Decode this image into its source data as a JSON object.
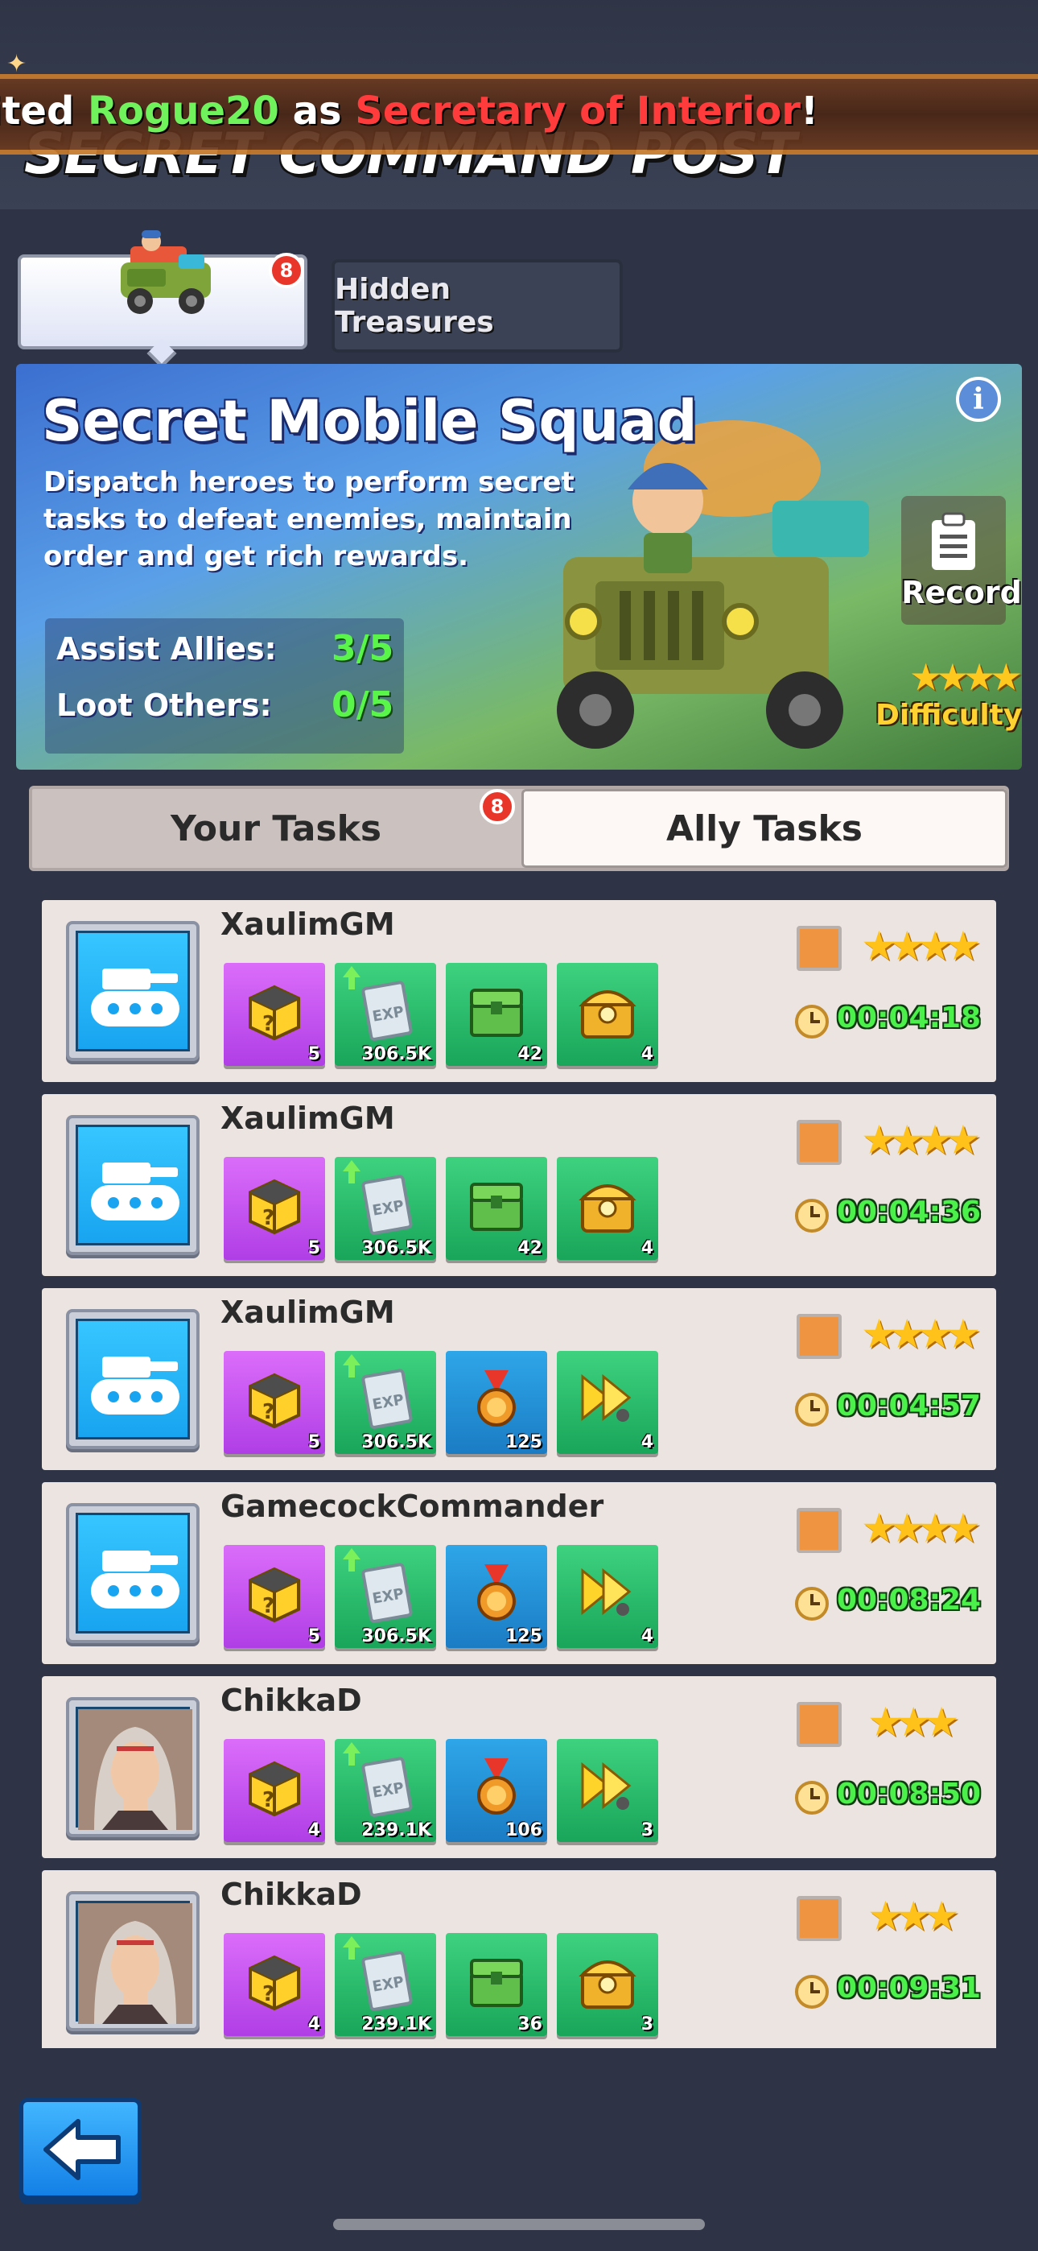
{
  "header": {
    "title": "SECRET COMMAND POST",
    "marquee": {
      "prefix": "ited ",
      "player": "Rogue20",
      "middle": " as ",
      "role": "Secretary of Interior",
      "suffix": "!"
    }
  },
  "top_tabs": {
    "jeep_badge": "8",
    "hidden_label": "Hidden Treasures"
  },
  "hero": {
    "title": "Secret Mobile Squad",
    "description": "Dispatch heroes to perform secret tasks to defeat enemies, maintain order and get rich rewards.",
    "stats": [
      {
        "label": "Assist Allies:",
        "value": "3/5"
      },
      {
        "label": "Loot Others:",
        "value": "0/5"
      }
    ],
    "info_icon": "i",
    "record_label": "Record",
    "difficulty_label": "Difficulty",
    "difficulty_stars": "★★★★"
  },
  "sub_tabs": {
    "your_tasks": "Your Tasks",
    "ally_tasks": "Ally Tasks",
    "badge": "8"
  },
  "tasks": [
    {
      "name": "XaulimGM",
      "avatar": "tank",
      "stars": "★★★★",
      "timer": "00:04:18",
      "rewards": [
        {
          "kind": "mystery-box",
          "color": "purple",
          "count": "5"
        },
        {
          "kind": "exp-book",
          "color": "green",
          "count": "306.5K"
        },
        {
          "kind": "green-chest",
          "color": "green",
          "count": "42"
        },
        {
          "kind": "gold-chest",
          "color": "green",
          "count": "4"
        }
      ]
    },
    {
      "name": "XaulimGM",
      "avatar": "tank",
      "stars": "★★★★",
      "timer": "00:04:36",
      "rewards": [
        {
          "kind": "mystery-box",
          "color": "purple",
          "count": "5"
        },
        {
          "kind": "exp-book",
          "color": "green",
          "count": "306.5K"
        },
        {
          "kind": "green-chest",
          "color": "green",
          "count": "42"
        },
        {
          "kind": "gold-chest",
          "color": "green",
          "count": "4"
        }
      ]
    },
    {
      "name": "XaulimGM",
      "avatar": "tank",
      "stars": "★★★★",
      "timer": "00:04:57",
      "rewards": [
        {
          "kind": "mystery-box",
          "color": "purple",
          "count": "5"
        },
        {
          "kind": "exp-book",
          "color": "green",
          "count": "306.5K"
        },
        {
          "kind": "medal",
          "color": "blue",
          "count": "125"
        },
        {
          "kind": "speedup",
          "color": "green",
          "count": "4"
        }
      ]
    },
    {
      "name": "GamecockCommander",
      "avatar": "tank",
      "stars": "★★★★",
      "timer": "00:08:24",
      "rewards": [
        {
          "kind": "mystery-box",
          "color": "purple",
          "count": "5"
        },
        {
          "kind": "exp-book",
          "color": "green",
          "count": "306.5K"
        },
        {
          "kind": "medal",
          "color": "blue",
          "count": "125"
        },
        {
          "kind": "speedup",
          "color": "green",
          "count": "4"
        }
      ]
    },
    {
      "name": "ChikkaD",
      "avatar": "portrait",
      "stars": "★★★",
      "timer": "00:08:50",
      "rewards": [
        {
          "kind": "mystery-box",
          "color": "purple",
          "count": "4"
        },
        {
          "kind": "exp-book",
          "color": "green",
          "count": "239.1K"
        },
        {
          "kind": "medal",
          "color": "blue",
          "count": "106"
        },
        {
          "kind": "speedup",
          "color": "green",
          "count": "3"
        }
      ]
    },
    {
      "name": "ChikkaD",
      "avatar": "portrait",
      "stars": "★★★",
      "timer": "00:09:31",
      "rewards": [
        {
          "kind": "mystery-box",
          "color": "purple",
          "count": "4"
        },
        {
          "kind": "exp-book",
          "color": "green",
          "count": "239.1K"
        },
        {
          "kind": "green-chest",
          "color": "green",
          "count": "36"
        },
        {
          "kind": "gold-chest",
          "color": "green",
          "count": "3"
        }
      ]
    }
  ],
  "back_button": "back-arrow-icon"
}
